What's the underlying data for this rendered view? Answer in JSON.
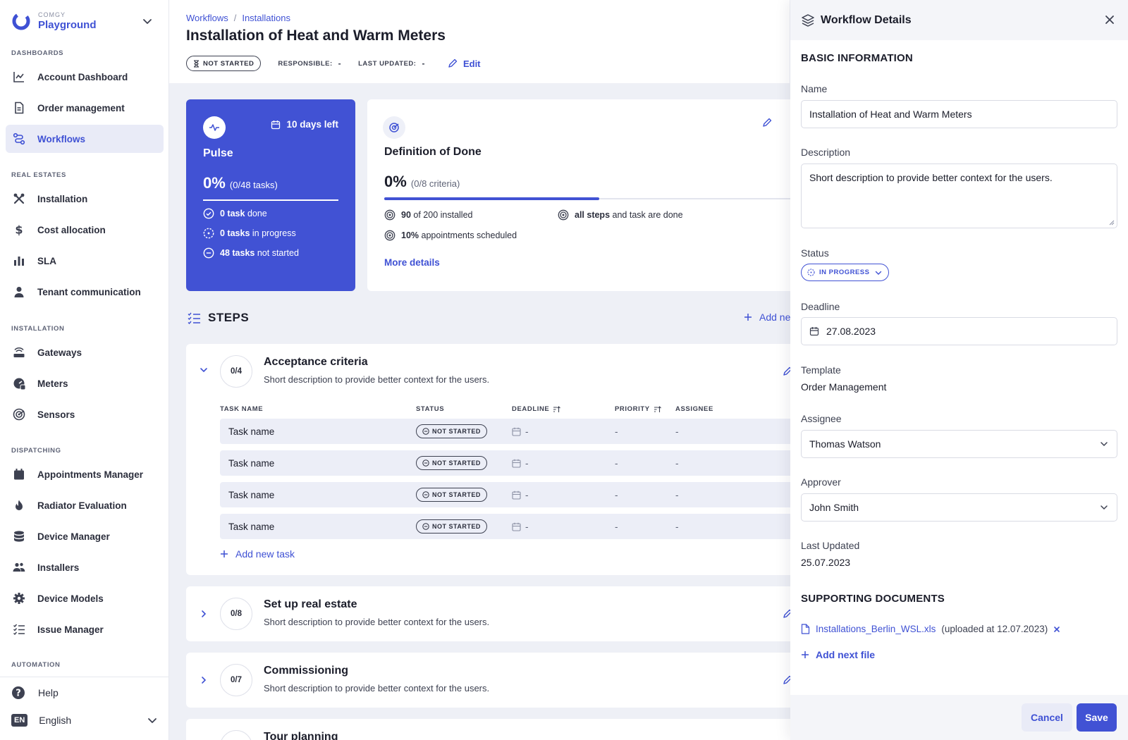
{
  "brand": {
    "company": "COMGY",
    "name": "Playground"
  },
  "sidebar": {
    "sections": [
      {
        "label": "DASHBOARDS",
        "items": [
          {
            "label": "Account Dashboard",
            "icon": "chart-line-icon"
          },
          {
            "label": "Order management",
            "icon": "document-icon"
          },
          {
            "label": "Workflows",
            "icon": "workflow-icon",
            "active": true
          }
        ]
      },
      {
        "label": "REAL ESTATES",
        "items": [
          {
            "label": "Installation",
            "icon": "tools-icon"
          },
          {
            "label": "Cost allocation",
            "icon": "dollar-icon"
          },
          {
            "label": "SLA",
            "icon": "bar-chart-icon"
          },
          {
            "label": "Tenant communication",
            "icon": "person-icon"
          }
        ]
      },
      {
        "label": "INSTALLATION",
        "items": [
          {
            "label": "Gateways",
            "icon": "router-icon"
          },
          {
            "label": "Meters",
            "icon": "meter-icon"
          },
          {
            "label": "Sensors",
            "icon": "sensor-icon"
          }
        ]
      },
      {
        "label": "DISPATCHING",
        "items": [
          {
            "label": "Appointments Manager",
            "icon": "calendar-icon"
          },
          {
            "label": "Radiator Evaluation",
            "icon": "flame-icon"
          },
          {
            "label": "Device Manager",
            "icon": "database-icon"
          },
          {
            "label": "Installers",
            "icon": "people-icon"
          },
          {
            "label": "Device Models",
            "icon": "gear-icon"
          },
          {
            "label": "Issue Manager",
            "icon": "checklist-icon"
          }
        ]
      },
      {
        "label": "AUTOMATION",
        "items": []
      }
    ],
    "help": "Help",
    "language": {
      "code": "EN",
      "label": "English"
    }
  },
  "header": {
    "breadcrumbs": [
      "Workflows",
      "Installations"
    ],
    "title": "Installation of Heat and Warm Meters",
    "status": "NOT STARTED",
    "responsible_label": "RESPONSIBLE:",
    "responsible_value": "-",
    "last_updated_label": "LAST UPDATED:",
    "last_updated_value": "-",
    "edit_label": "Edit"
  },
  "pulse": {
    "days_left": "10 days left",
    "title": "Pulse",
    "percent": "0%",
    "tasks_ratio": "(0/48 tasks)",
    "rows": [
      {
        "bold": "0 task",
        "text": "done",
        "icon": "check-circle-icon"
      },
      {
        "bold": "0 tasks",
        "text": "in progress",
        "icon": "progress-circle-icon"
      },
      {
        "bold": "48 tasks",
        "text": "not started",
        "icon": "minus-circle-icon"
      }
    ]
  },
  "dod": {
    "title": "Definition of Done",
    "percent": "0%",
    "criteria_ratio": "(0/8 criteria)",
    "progress": 0.52,
    "criteria": [
      {
        "bold": "90",
        "text": "of 200 installed"
      },
      {
        "bold": "all steps",
        "text": "and task are done"
      },
      {
        "bold": "10%",
        "text": "appointments scheduled"
      }
    ],
    "more_details": "More details"
  },
  "steps": {
    "title": "STEPS",
    "add_label": "Add ne",
    "columns": {
      "task_name": "TASK NAME",
      "status": "STATUS",
      "deadline": "DEADLINE",
      "priority": "PRIORITY",
      "assignee": "ASSIGNEE"
    },
    "items": [
      {
        "count": "0/4",
        "title": "Acceptance criteria",
        "desc": "Short description to provide better context for the users."
      },
      {
        "count": "0/8",
        "title": "Set up real estate",
        "desc": "Short description to provide better context for the users."
      },
      {
        "count": "0/7",
        "title": "Commissioning",
        "desc": "Short description to provide better context for the users."
      },
      {
        "count": "",
        "title": "Tour planning",
        "desc": ""
      }
    ],
    "tasks": [
      {
        "name": "Task name",
        "status": "NOT STARTED",
        "deadline": "-",
        "priority": "-",
        "assignee": "-"
      },
      {
        "name": "Task name",
        "status": "NOT STARTED",
        "deadline": "-",
        "priority": "-",
        "assignee": "-"
      },
      {
        "name": "Task name",
        "status": "NOT STARTED",
        "deadline": "-",
        "priority": "-",
        "assignee": "-"
      },
      {
        "name": "Task name",
        "status": "NOT STARTED",
        "deadline": "-",
        "priority": "-",
        "assignee": "-"
      }
    ],
    "add_task": "Add new task"
  },
  "panel": {
    "title": "Workflow Details",
    "basic_info": "BASIC INFORMATION",
    "name_label": "Name",
    "name_value": "Installation of Heat and Warm Meters",
    "description_label": "Description",
    "description_value": "Short description to provide better context for the users.",
    "status_label": "Status",
    "status_value": "IN PROGRESS",
    "deadline_label": "Deadline",
    "deadline_value": "27.08.2023",
    "template_label": "Template",
    "template_value": "Order Management",
    "assignee_label": "Assignee",
    "assignee_value": "Thomas Watson",
    "approver_label": "Approver",
    "approver_value": "John Smith",
    "last_updated_label": "Last Updated",
    "last_updated_value": "25.07.2023",
    "docs_title": "SUPPORTING DOCUMENTS",
    "doc_name": "Installations_Berlin_WSL.xls",
    "doc_uploaded": "(uploaded at 12.07.2023)",
    "add_file": "Add next file",
    "cancel": "Cancel",
    "save": "Save"
  },
  "colors": {
    "accent": "#4152d4",
    "text": "#1b1d2a",
    "muted": "#3d4151",
    "surface": "#eef0f6"
  }
}
